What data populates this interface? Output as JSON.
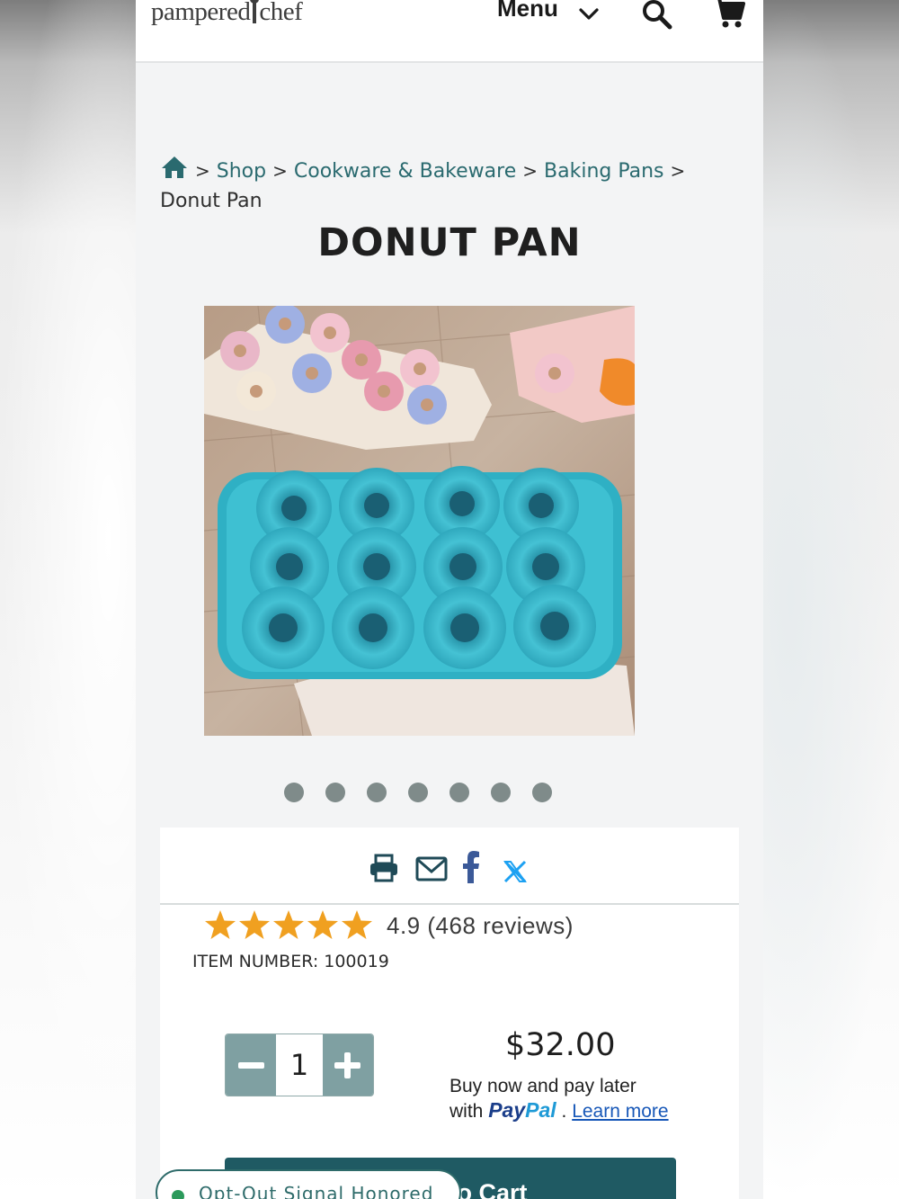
{
  "header": {
    "logo_left": "pampered",
    "logo_right": "chef",
    "menu_label": "Menu"
  },
  "breadcrumb": {
    "items": [
      "Shop",
      "Cookware & Bakeware",
      "Baking Pans"
    ],
    "current": "Donut Pan",
    "separator": ">"
  },
  "product": {
    "title": "DONUT PAN",
    "image_alt": "Teal donut pan with glazed mini donuts",
    "carousel_dots": 7,
    "rating_value": "4.9",
    "rating_text": "4.9 (468 reviews)",
    "stars": 5,
    "item_number": "ITEM NUMBER: 100019",
    "quantity": "1",
    "price": "$32.00",
    "pay_later_line1": "Buy now and pay later",
    "pay_later_with": "with",
    "paypal_pay": "Pay",
    "paypal_pal": "Pal",
    "pay_later_dot": ".",
    "learn_more": "Learn more",
    "add_to_cart": "Add to Cart"
  },
  "share": {
    "icons": [
      "print-icon",
      "email-icon",
      "facebook-icon",
      "x-icon"
    ]
  },
  "privacy_badge": {
    "label": "Opt-Out Signal Honored"
  },
  "colors": {
    "teal_link": "#2a6a6f",
    "button_dark": "#1f5a63",
    "stepper": "#7fa0a2",
    "star": "#f0a020",
    "paypal_dark": "#1b3e8a",
    "paypal_light": "#1f9ad6"
  }
}
